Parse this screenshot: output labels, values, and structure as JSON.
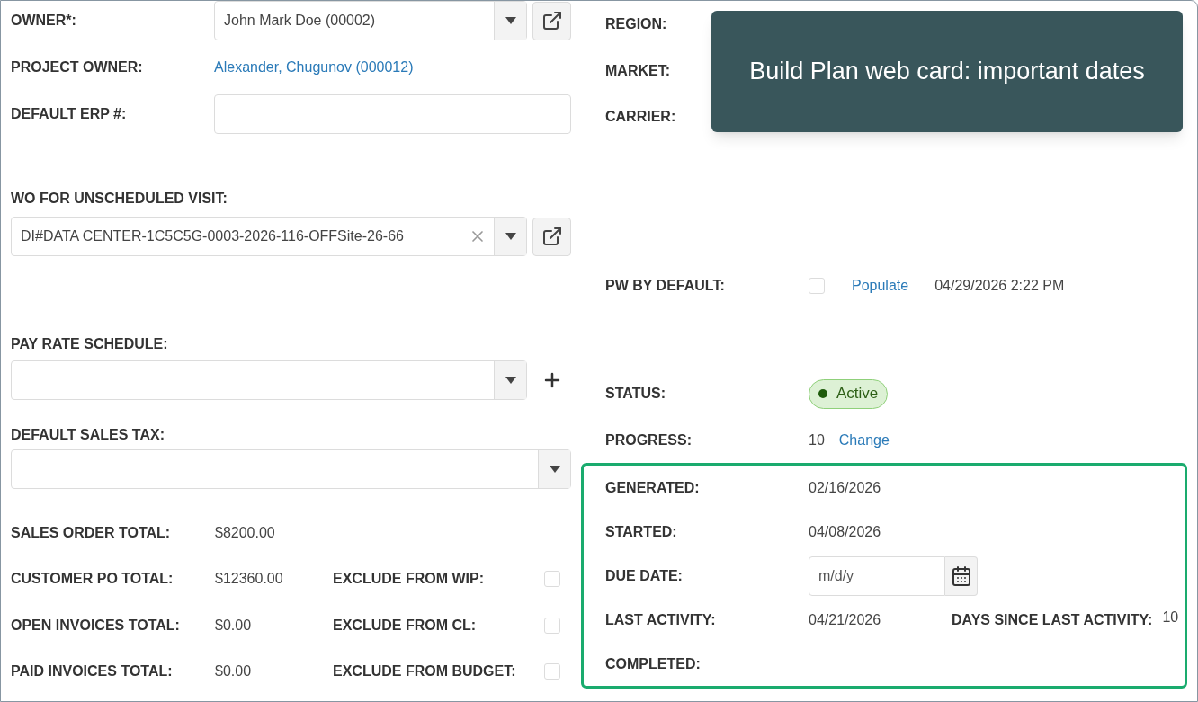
{
  "owner": {
    "label": "OWNER*:",
    "value": "John Mark Doe (00002)"
  },
  "project_owner": {
    "label": "PROJECT OWNER:",
    "value": "Alexander, Chugunov (000012)"
  },
  "default_erp": {
    "label": "DEFAULT ERP #:"
  },
  "wo_unscheduled": {
    "label": "WO FOR UNSCHEDULED VISIT:",
    "value": "DI#DATA CENTER-1C5C5G-0003-2026-116-OFFSite-26-66"
  },
  "pay_rate_schedule": {
    "label": "PAY RATE SCHEDULE:"
  },
  "default_sales_tax": {
    "label": "DEFAULT SALES TAX:"
  },
  "totals": [
    {
      "label": "SALES ORDER TOTAL:",
      "value": "$8200.00"
    },
    {
      "label": "CUSTOMER PO TOTAL:",
      "value": "$12360.00",
      "exclude": {
        "label": "EXCLUDE FROM WIP:",
        "checked": false
      }
    },
    {
      "label": "OPEN INVOICES TOTAL:",
      "value": "$0.00",
      "exclude": {
        "label": "EXCLUDE FROM CL:",
        "checked": false
      }
    },
    {
      "label": "PAID INVOICES TOTAL:",
      "value": "$0.00",
      "exclude": {
        "label": "EXCLUDE FROM BUDGET:",
        "checked": false
      }
    }
  ],
  "region": {
    "label": "REGION:"
  },
  "market": {
    "label": "MARKET:"
  },
  "carrier": {
    "label": "CARRIER:"
  },
  "pw_by_default": {
    "label": "PW BY DEFAULT:",
    "checked": false,
    "link": "Populate",
    "timestamp": "04/29/2026 2:22 PM"
  },
  "status": {
    "label": "STATUS:",
    "value": "Active"
  },
  "progress": {
    "label": "PROGRESS:",
    "value": "10",
    "link": "Change"
  },
  "important_dates": [
    {
      "kind": "text",
      "label": "GENERATED:",
      "value": "02/16/2026"
    },
    {
      "kind": "text",
      "label": "STARTED:",
      "value": "04/08/2026"
    },
    {
      "kind": "date_input",
      "label": "DUE DATE:",
      "placeholder": "m/d/y"
    },
    {
      "kind": "text",
      "label": "LAST ACTIVITY:",
      "value": "04/21/2026",
      "extra": {
        "label": "DAYS SINCE LAST ACTIVITY:",
        "value": "10"
      }
    },
    {
      "kind": "text",
      "label": "COMPLETED:"
    }
  ],
  "tooltip": {
    "text": "Build Plan web card: important dates"
  }
}
